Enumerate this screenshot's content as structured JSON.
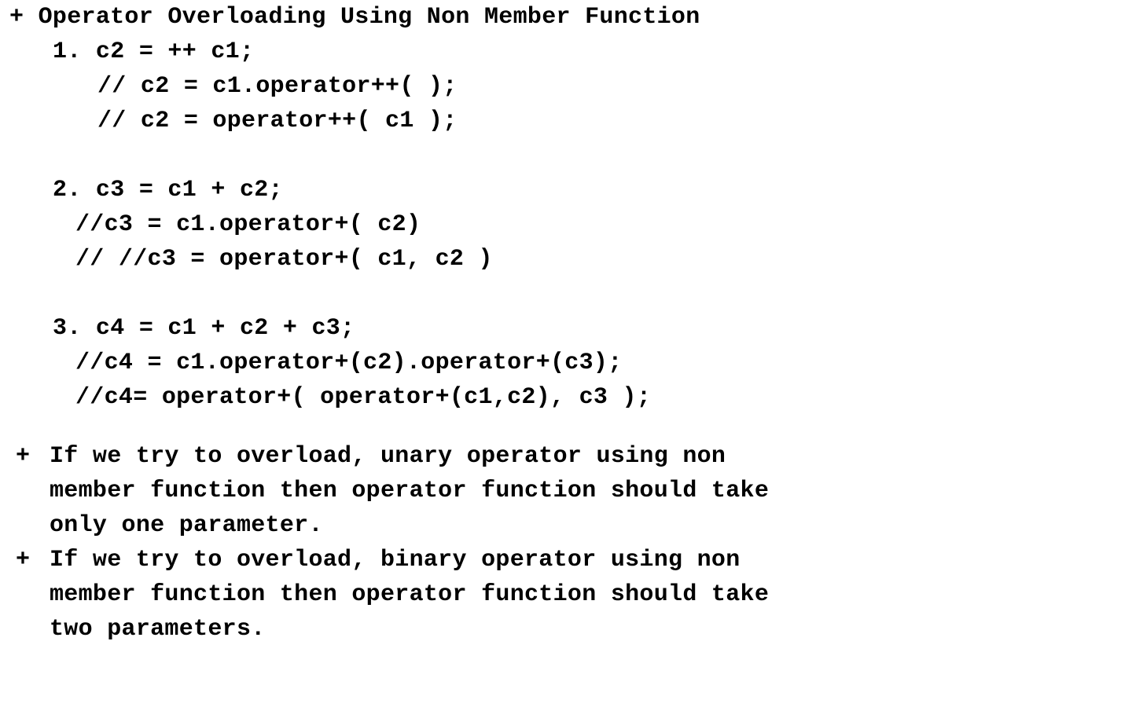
{
  "heading": "+ Operator Overloading Using Non Member Function",
  "examples": [
    {
      "statement": "1. c2 = ++ c1;",
      "comments": [
        "// c2 = c1.operator++( );",
        "// c2 = operator++( c1 );"
      ]
    },
    {
      "statement": "2. c3 = c1 + c2;",
      "comments": [
        "//c3 = c1.operator+( c2)",
        "// //c3 = operator+( c1, c2 )"
      ]
    },
    {
      "statement": "3. c4 = c1 + c2 + c3;",
      "comments": [
        "//c4 = c1.operator+(c2).operator+(c3);",
        "//c4= operator+( operator+(c1,c2), c3 );"
      ]
    }
  ],
  "notes": [
    {
      "bullet": "+",
      "lines": [
        "If we try to overload, unary operator using non",
        "member function then operator function should take",
        "only one parameter."
      ]
    },
    {
      "bullet": "+",
      "lines": [
        "If we try to overload, binary operator using non",
        "member function then operator function should take",
        "two parameters."
      ]
    }
  ]
}
